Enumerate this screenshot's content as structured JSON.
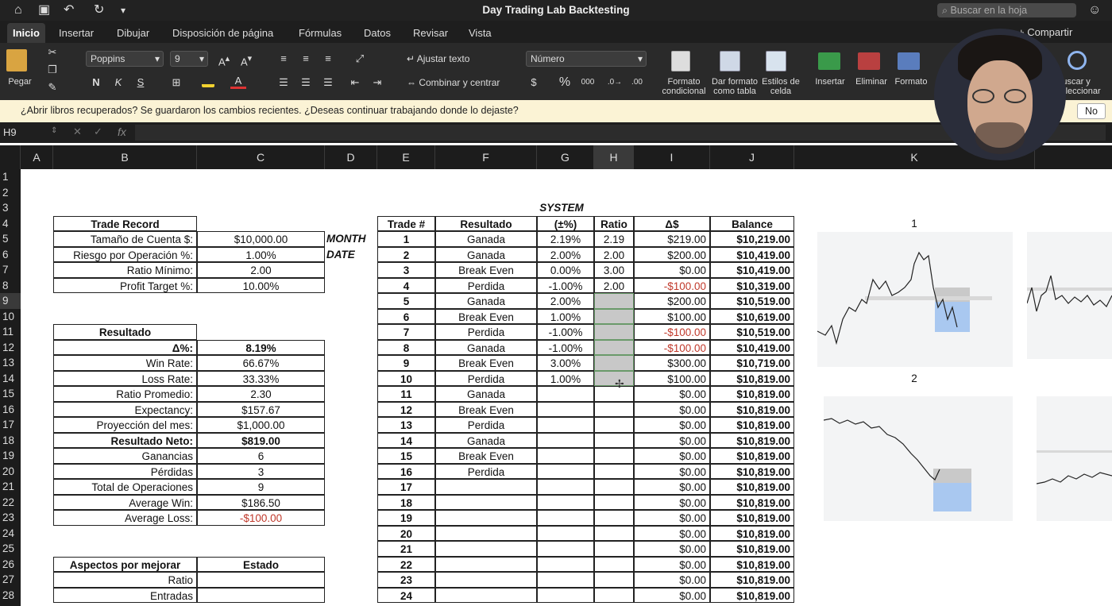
{
  "window": {
    "title": "Day Trading Lab Backtesting",
    "search_placeholder": "Buscar en la hoja"
  },
  "tabs": [
    "Inicio",
    "Insertar",
    "Dibujar",
    "Disposición de página",
    "Fórmulas",
    "Datos",
    "Revisar",
    "Vista"
  ],
  "share_label": "+ Compartir",
  "ribbon": {
    "paste": "Pegar",
    "font_name": "Poppins",
    "font_size": "9",
    "bold": "N",
    "italic": "K",
    "underline": "S",
    "wrap_text": "Ajustar texto",
    "merge_center": "Combinar y centrar",
    "number_format": "Número",
    "currency": "$",
    "percent": "%",
    "thousands": "000",
    "conditional_format": "Formato condicional",
    "format_table": "Dar formato como tabla",
    "cell_styles": "Estilos de celda",
    "insert": "Insertar",
    "delete": "Eliminar",
    "format": "Formato",
    "find_select": "Buscar y seleccionar"
  },
  "notification": {
    "message": "¿Abrir libros recuperados?   Se guardaron los cambios recientes. ¿Deseas continuar trabajando donde lo dejaste?",
    "no_label": "No"
  },
  "formula_bar": {
    "cell_ref": "H9",
    "fx": "fx"
  },
  "columns": [
    "A",
    "B",
    "C",
    "D",
    "E",
    "F",
    "G",
    "H",
    "I",
    "J",
    "K"
  ],
  "rows": [
    "1",
    "2",
    "3",
    "4",
    "5",
    "6",
    "7",
    "8",
    "9",
    "10",
    "11",
    "12",
    "13",
    "14",
    "15",
    "16",
    "17",
    "18",
    "19",
    "20",
    "21",
    "22",
    "23",
    "24",
    "25",
    "26",
    "27",
    "28"
  ],
  "trade_record": {
    "title": "Trade Record",
    "rows": [
      {
        "label": "Tamaño de Cuenta $:",
        "value": "$10,000.00"
      },
      {
        "label": "Riesgo por Operación %:",
        "value": "1.00%"
      },
      {
        "label": "Ratio Mínimo:",
        "value": "2.00"
      },
      {
        "label": "Profit Target %:",
        "value": "10.00%"
      }
    ],
    "month": "MONTH",
    "date": "DATE"
  },
  "resultado": {
    "title": "Resultado",
    "rows": [
      {
        "label": "Δ%:",
        "value": "8.19%",
        "bold": true
      },
      {
        "label": "Win Rate:",
        "value": "66.67%"
      },
      {
        "label": "Loss Rate:",
        "value": "33.33%"
      },
      {
        "label": "Ratio Promedio:",
        "value": "2.30"
      },
      {
        "label": "Expectancy:",
        "value": "$157.67"
      },
      {
        "label": "Proyección del mes:",
        "value": "$1,000.00"
      },
      {
        "label": "Resultado Neto:",
        "value": "$819.00",
        "bold": true
      },
      {
        "label": "Ganancias",
        "value": "6"
      },
      {
        "label": "Pérdidas",
        "value": "3"
      },
      {
        "label": "Total de Operaciones",
        "value": "9"
      },
      {
        "label": "Average Win:",
        "value": "$186.50"
      },
      {
        "label": "Average Loss:",
        "value": "-$100.00",
        "red": true
      }
    ]
  },
  "aspectos": {
    "header": [
      "Aspectos por mejorar",
      "Estado"
    ],
    "rows": [
      "Ratio",
      "Entradas"
    ]
  },
  "system": {
    "title": "SYSTEM",
    "headers": [
      "Trade #",
      "Resultado",
      "(±%)",
      "Ratio",
      "Δ$",
      "Balance"
    ],
    "trades": [
      {
        "n": "1",
        "res": "Ganada",
        "pct": "2.19%",
        "ratio": "2.19",
        "d": "$219.00",
        "bal": "$10,219.00"
      },
      {
        "n": "2",
        "res": "Ganada",
        "pct": "2.00%",
        "ratio": "2.00",
        "d": "$200.00",
        "bal": "$10,419.00"
      },
      {
        "n": "3",
        "res": "Break Even",
        "pct": "0.00%",
        "ratio": "3.00",
        "d": "$0.00",
        "bal": "$10,419.00"
      },
      {
        "n": "4",
        "res": "Perdida",
        "pct": "-1.00%",
        "ratio": "2.00",
        "d": "-$100.00",
        "bal": "$10,319.00",
        "neg": true
      },
      {
        "n": "5",
        "res": "Ganada",
        "pct": "2.00%",
        "ratio": "",
        "d": "$200.00",
        "bal": "$10,519.00"
      },
      {
        "n": "6",
        "res": "Break Even",
        "pct": "1.00%",
        "ratio": "",
        "d": "$100.00",
        "bal": "$10,619.00"
      },
      {
        "n": "7",
        "res": "Perdida",
        "pct": "-1.00%",
        "ratio": "",
        "d": "-$100.00",
        "bal": "$10,519.00",
        "neg": true
      },
      {
        "n": "8",
        "res": "Ganada",
        "pct": "-1.00%",
        "ratio": "",
        "d": "-$100.00",
        "bal": "$10,419.00",
        "neg": true
      },
      {
        "n": "9",
        "res": "Break Even",
        "pct": "3.00%",
        "ratio": "",
        "d": "$300.00",
        "bal": "$10,719.00"
      },
      {
        "n": "10",
        "res": "Perdida",
        "pct": "1.00%",
        "ratio": "",
        "d": "$100.00",
        "bal": "$10,819.00"
      },
      {
        "n": "11",
        "res": "Ganada",
        "pct": "",
        "ratio": "",
        "d": "$0.00",
        "bal": "$10,819.00"
      },
      {
        "n": "12",
        "res": "Break Even",
        "pct": "",
        "ratio": "",
        "d": "$0.00",
        "bal": "$10,819.00"
      },
      {
        "n": "13",
        "res": "Perdida",
        "pct": "",
        "ratio": "",
        "d": "$0.00",
        "bal": "$10,819.00"
      },
      {
        "n": "14",
        "res": "Ganada",
        "pct": "",
        "ratio": "",
        "d": "$0.00",
        "bal": "$10,819.00"
      },
      {
        "n": "15",
        "res": "Break Even",
        "pct": "",
        "ratio": "",
        "d": "$0.00",
        "bal": "$10,819.00"
      },
      {
        "n": "16",
        "res": "Perdida",
        "pct": "",
        "ratio": "",
        "d": "$0.00",
        "bal": "$10,819.00"
      },
      {
        "n": "17",
        "res": "",
        "pct": "",
        "ratio": "",
        "d": "$0.00",
        "bal": "$10,819.00"
      },
      {
        "n": "18",
        "res": "",
        "pct": "",
        "ratio": "",
        "d": "$0.00",
        "bal": "$10,819.00"
      },
      {
        "n": "19",
        "res": "",
        "pct": "",
        "ratio": "",
        "d": "$0.00",
        "bal": "$10,819.00"
      },
      {
        "n": "20",
        "res": "",
        "pct": "",
        "ratio": "",
        "d": "$0.00",
        "bal": "$10,819.00"
      },
      {
        "n": "21",
        "res": "",
        "pct": "",
        "ratio": "",
        "d": "$0.00",
        "bal": "$10,819.00"
      },
      {
        "n": "22",
        "res": "",
        "pct": "",
        "ratio": "",
        "d": "$0.00",
        "bal": "$10,819.00"
      },
      {
        "n": "23",
        "res": "",
        "pct": "",
        "ratio": "",
        "d": "$0.00",
        "bal": "$10,819.00"
      },
      {
        "n": "24",
        "res": "",
        "pct": "",
        "ratio": "",
        "d": "$0.00",
        "bal": "$10,819.00"
      }
    ]
  },
  "screenshots": {
    "label_1": "1",
    "label_2": "2"
  },
  "colors": {
    "negative": "#c0392b",
    "ribbon_bg": "#2a2a2a",
    "notification_bg": "#fbf3d5"
  }
}
